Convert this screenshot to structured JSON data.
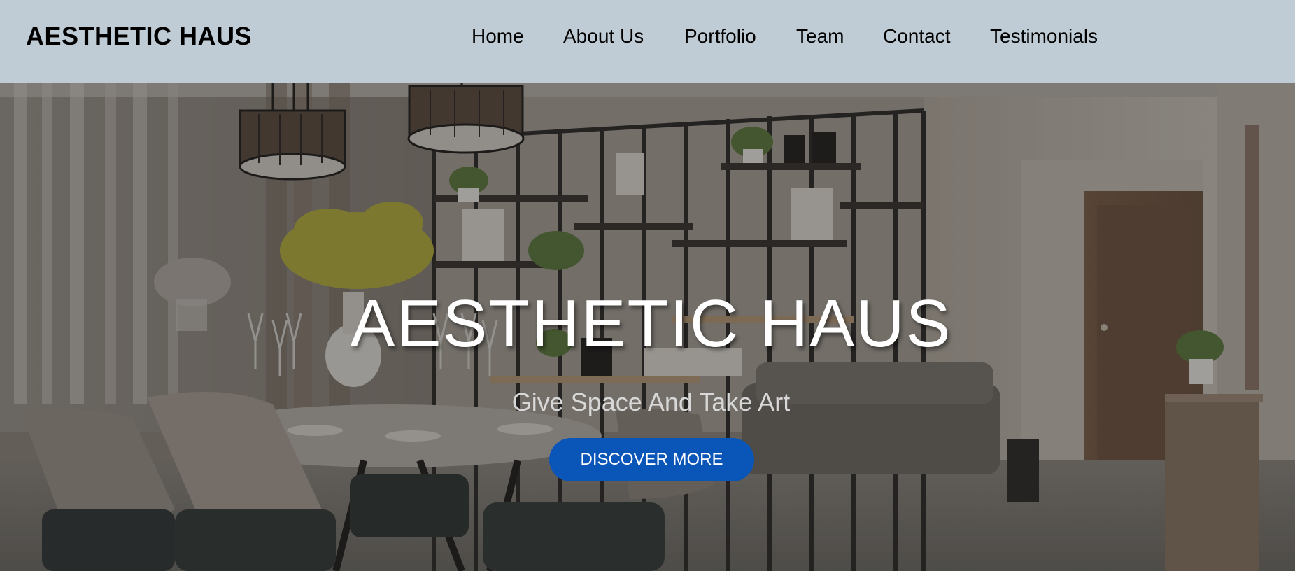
{
  "header": {
    "brand": "AESTHETIC HAUS",
    "nav": [
      {
        "label": "Home"
      },
      {
        "label": "About Us"
      },
      {
        "label": "Portfolio"
      },
      {
        "label": "Team"
      },
      {
        "label": "Contact"
      },
      {
        "label": "Testimonials"
      }
    ],
    "background_color": "#bfccd5"
  },
  "hero": {
    "title": "AESTHETIC HAUS",
    "subtitle": "Give Space And Take Art",
    "cta_label": "DISCOVER MORE",
    "cta_color": "#0a55b8",
    "background_image": "interior-dining-room-photo"
  }
}
